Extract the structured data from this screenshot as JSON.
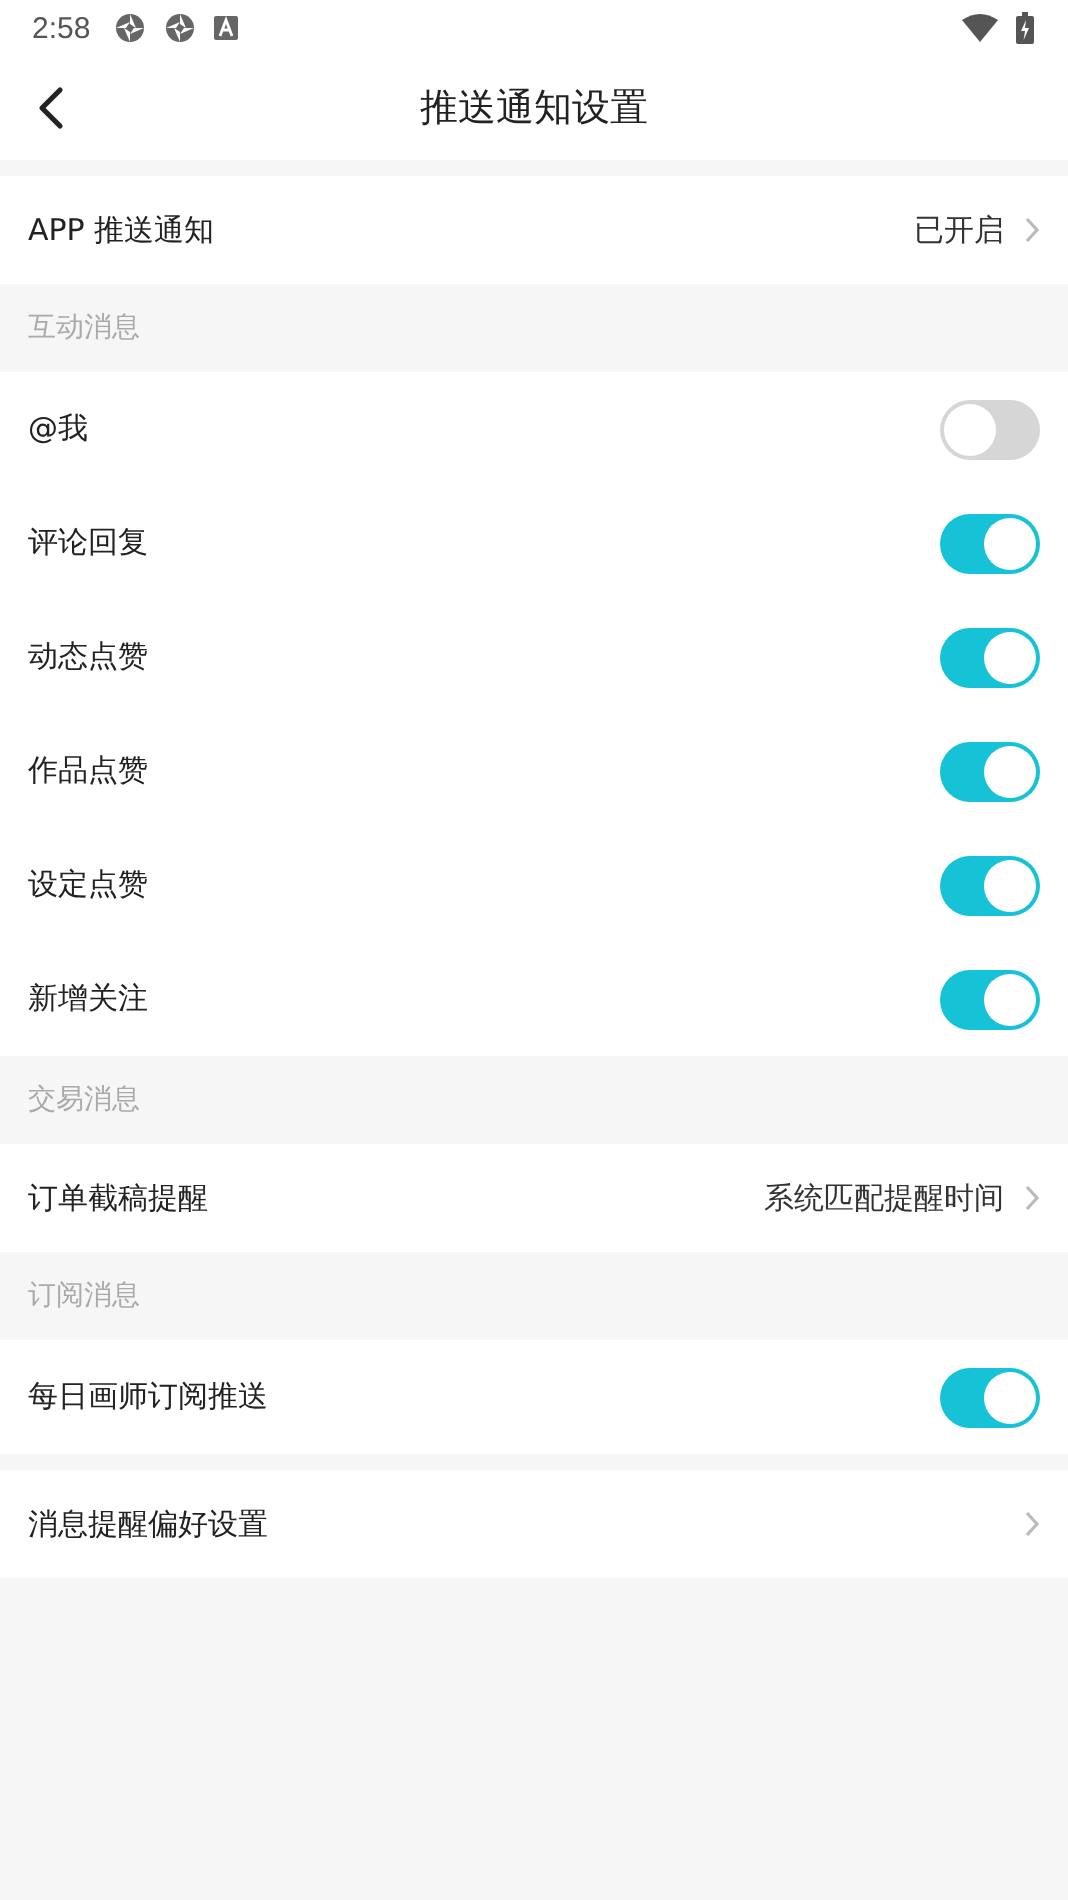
{
  "status_bar": {
    "time": "2:58"
  },
  "header": {
    "title": "推送通知设置"
  },
  "groups": [
    {
      "rows": [
        {
          "kind": "link",
          "label": "APP 推送通知",
          "value": "已开启"
        }
      ]
    },
    {
      "header": "互动消息",
      "rows": [
        {
          "kind": "toggle",
          "label": "@我",
          "on": false
        },
        {
          "kind": "toggle",
          "label": "评论回复",
          "on": true
        },
        {
          "kind": "toggle",
          "label": "动态点赞",
          "on": true
        },
        {
          "kind": "toggle",
          "label": "作品点赞",
          "on": true
        },
        {
          "kind": "toggle",
          "label": "设定点赞",
          "on": true
        },
        {
          "kind": "toggle",
          "label": "新增关注",
          "on": true
        }
      ]
    },
    {
      "header": "交易消息",
      "rows": [
        {
          "kind": "link",
          "label": "订单截稿提醒",
          "value": "系统匹配提醒时间"
        }
      ]
    },
    {
      "header": "订阅消息",
      "rows": [
        {
          "kind": "toggle",
          "label": "每日画师订阅推送",
          "on": true
        }
      ]
    },
    {
      "rows": [
        {
          "kind": "link",
          "label": "消息提醒偏好设置"
        }
      ]
    }
  ]
}
